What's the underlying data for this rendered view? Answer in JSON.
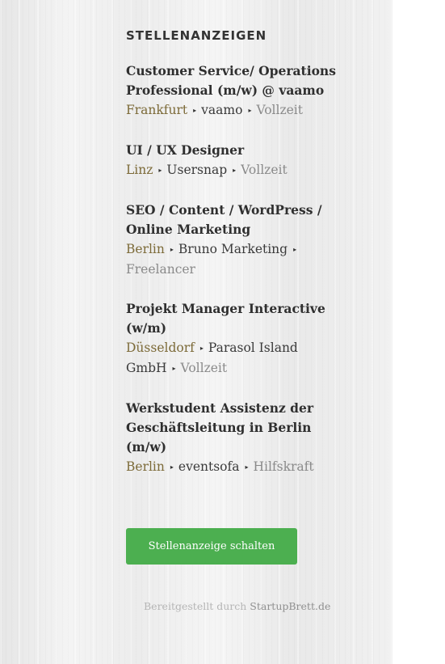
{
  "widget": {
    "title": "STELLENANZEIGEN",
    "jobs": [
      {
        "title": "Customer Service/ Operations Professional (m/w) @ vaamo",
        "location": "Frankfurt",
        "company": "vaamo",
        "type": "Vollzeit"
      },
      {
        "title": "UI / UX Designer",
        "location": "Linz",
        "company": "Usersnap",
        "type": "Vollzeit"
      },
      {
        "title": "SEO / Content / WordPress / Online Marketing",
        "location": "Berlin",
        "company": "Bruno Marketing",
        "type": "Freelancer"
      },
      {
        "title": "Projekt Manager Interactive (w/m)",
        "location": "Düsseldorf",
        "company": "Parasol Island GmbH",
        "type": "Vollzeit"
      },
      {
        "title": "Werkstudent Assistenz der Geschäftsleitung in Berlin (m/w)",
        "location": "Berlin",
        "company": "eventsofa",
        "type": "Hilfskraft"
      }
    ],
    "separator": "▸",
    "cta_label": "Stellenanzeige schalten",
    "credit_prefix": "Bereitgestellt durch",
    "credit_link": "StartupBrett.de"
  },
  "colors": {
    "location": "#7c6a38",
    "type": "#8a8a8a",
    "cta_bg": "#4caf50"
  }
}
